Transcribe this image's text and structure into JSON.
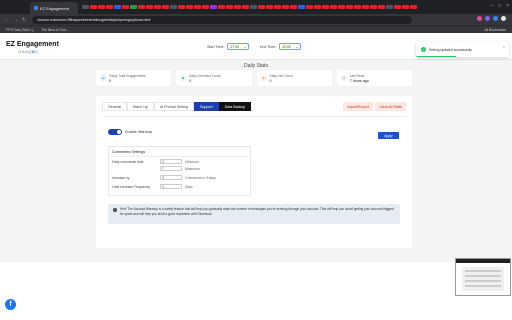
{
  "browser": {
    "tab_title": "EZ Engagement",
    "url": "chrome-extension://flfnaqonnbehembinngeeokhpkmpmmg/options.html",
    "bookmarks": [
      "FPTChat | BAILI |...",
      "The Best AI Tool..."
    ],
    "all_bookmarks": "All Bookmarks"
  },
  "header": {
    "brand": "EZ Engagement",
    "version_prefix": "v1.8.6",
    "version_link": "(CBC)",
    "start_time_label": "Start Time:",
    "start_time_value": "07:00",
    "end_time_label": "End Time:",
    "end_time_value": "22:00"
  },
  "toast": {
    "message": "Setting updated successfully"
  },
  "stats": {
    "title": "Daily Stats",
    "items": [
      {
        "label": "Today Total Engagements",
        "value": "0",
        "icon": "person-icon",
        "color": "#3b82f6",
        "bg": "#dbeafe"
      },
      {
        "label": "Daily Comment Count",
        "value": "0",
        "icon": "comment-icon",
        "color": "#16a34a",
        "bg": "#dcfce7"
      },
      {
        "label": "Daily Like Count",
        "value": "0",
        "icon": "like-icon",
        "color": "#f97316",
        "bg": "#ffedd5"
      },
      {
        "label": "Last Read",
        "value": "7 hours ago",
        "icon": "clock-icon",
        "color": "#6b7280",
        "bg": "#f3f4f6"
      }
    ]
  },
  "tabs": {
    "general": "General",
    "warm_up": "Warm Up",
    "ai_prompt": "AI Prompt Setting",
    "support": "Support",
    "data_backup": "Data Backup"
  },
  "actions": {
    "import_export": "Import/Export",
    "clear_stats": "Clear All Stats",
    "apply": "Apply"
  },
  "warmup": {
    "toggle_label": "Enable Warmup",
    "enabled": true
  },
  "comments_settings": {
    "title": "Comments Settings",
    "rows": [
      {
        "label": "Daily comments limit:",
        "value": "3",
        "unit": "Minimum"
      },
      {
        "label": "",
        "value": "7",
        "unit": "Maximum"
      },
      {
        "label": "Increase by",
        "value": "3",
        "unit": "Comments in 3 days"
      },
      {
        "label": "Limit Increase Frequency",
        "value": "3",
        "unit": "Days"
      }
    ]
  },
  "info": {
    "text": "Hint! The Account Warmup is a safety feature that will help you gradually raise the number of messages you're sending through your account. This will help you avoid getting your account flagged for spam and will help you build a good reputation with Facebook."
  },
  "colors": {
    "accent": "#1e40af",
    "danger_bg": "#fce7e2",
    "danger_text": "#c0392b",
    "success": "#22c55e"
  }
}
